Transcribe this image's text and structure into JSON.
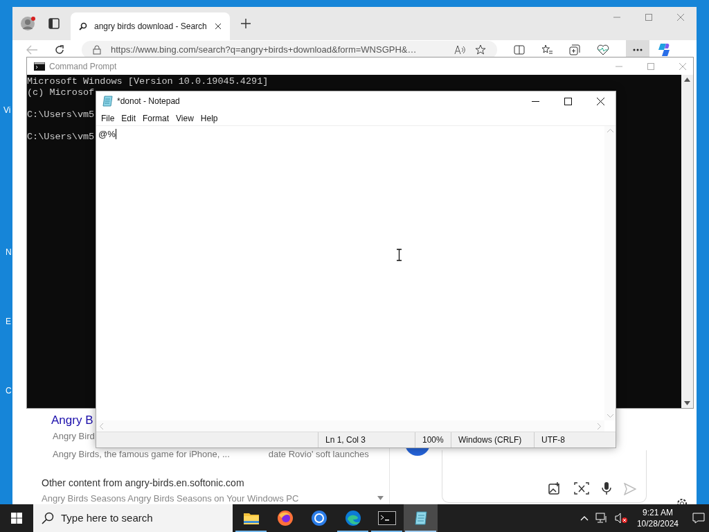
{
  "desktop": {
    "icon_labels": [
      "Vi",
      "N",
      "E",
      "C"
    ]
  },
  "browser": {
    "tabs": [
      {
        "title": "angry birds download - Search",
        "selected": true
      }
    ],
    "address": "https://www.bing.com/search?q=angry+birds+download&form=WNSGPH&…",
    "results": {
      "title": "Angry B",
      "url_line": "Angry Bird",
      "snippet": "Angry Birds, the famous game for iPhone, ...",
      "snippet_2": "date Rovio' soft launches",
      "other_heading": "Other content from angry-birds.en.softonic.com",
      "next_result": "Angry Birds Seasons Angry Birds Seasons on Your Windows PC"
    }
  },
  "command_prompt": {
    "title": "Command Prompt",
    "blocks": [
      [
        "Microsoft Windows [Version 10.0.19045.4291]",
        "(c) Microsof"
      ],
      [
        "C:\\Users\\vm5"
      ],
      [
        "C:\\Users\\vm5"
      ]
    ]
  },
  "notepad": {
    "title": "*donot - Notepad",
    "menu": [
      "File",
      "Edit",
      "Format",
      "View",
      "Help"
    ],
    "text": "@%",
    "status_bar": [
      "Ln 1, Col 3",
      "100%",
      "Windows (CRLF)",
      "UTF-8"
    ]
  },
  "taskbar": {
    "search_placeholder": "Type here to search",
    "apps": [
      {
        "kind": "explorer",
        "running": true,
        "selected": false
      },
      {
        "kind": "firefox",
        "running": false,
        "selected": false
      },
      {
        "kind": "chrome",
        "running": false,
        "selected": false
      },
      {
        "kind": "edge",
        "running": true,
        "selected": false
      },
      {
        "kind": "terminal",
        "running": true,
        "selected": false
      },
      {
        "kind": "notepad",
        "running": true,
        "selected": true
      }
    ],
    "time": "9:21 AM",
    "date": "10/28/2024"
  }
}
